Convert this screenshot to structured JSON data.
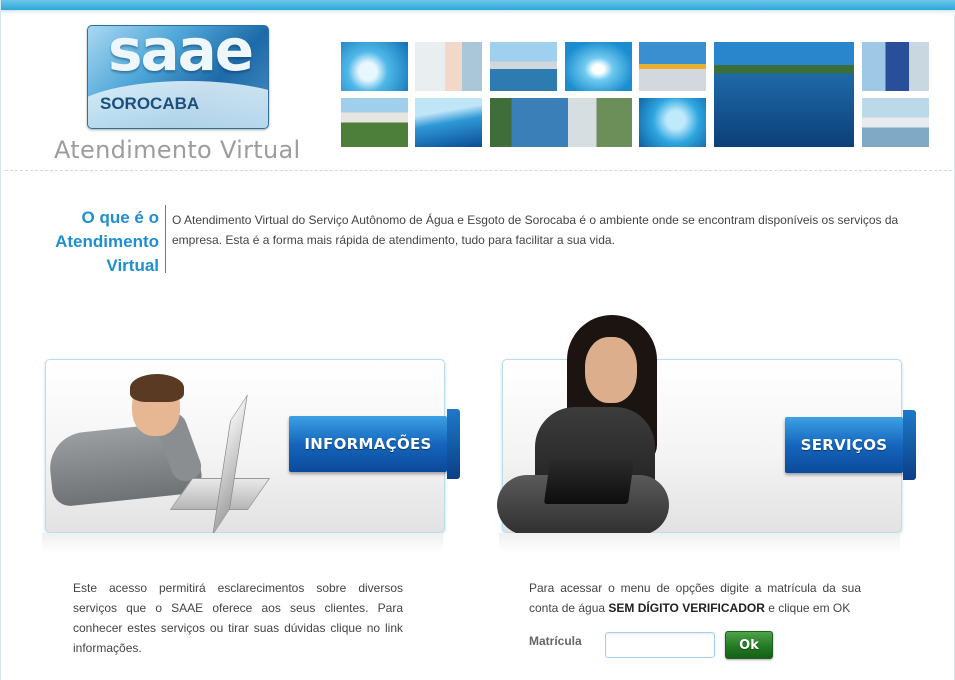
{
  "header": {
    "logo": {
      "word": "saae",
      "city": "SOROCABA"
    },
    "app_title": "Atendimento Virtual",
    "photo_tiles": [
      "water-splash",
      "woman-drinking-water",
      "reservoir",
      "water-drop",
      "treatment-station",
      "lake",
      "technician",
      "river",
      "water-surface",
      "dam",
      "water-bubbles",
      "pier"
    ]
  },
  "about": {
    "heading_line1": "O que é o",
    "heading_line2": "Atendimento",
    "heading_line3": "Virtual",
    "text": "O Atendimento Virtual do Serviço Autônomo de Água e Esgoto de Sorocaba é o ambiente onde se encontram disponíveis os serviços da empresa. Esta é a forma mais rápida de atendimento, tudo para facilitar a sua vida."
  },
  "informacoes": {
    "button_label": "INFORMAÇÕES",
    "description": "Este acesso permitirá esclarecimentos sobre diversos serviços que o SAAE oferece aos seus clientes. Para conhecer estes serviços ou tirar suas dúvidas clique no link informações."
  },
  "servicos": {
    "button_label": "SERVIÇOS",
    "description_prefix": "Para acessar o menu de opções digite a matrícula da sua conta de água ",
    "description_bold": "SEM DÍGITO VERIFICADOR",
    "description_suffix": " e clique em OK",
    "field_label": "Matrícula",
    "field_value": "",
    "ok_label": "Ok"
  },
  "colors": {
    "accent": "#1e8fd0",
    "ribbon_blue": "#1566bd",
    "ok_green": "#237a23",
    "text": "#444444"
  }
}
